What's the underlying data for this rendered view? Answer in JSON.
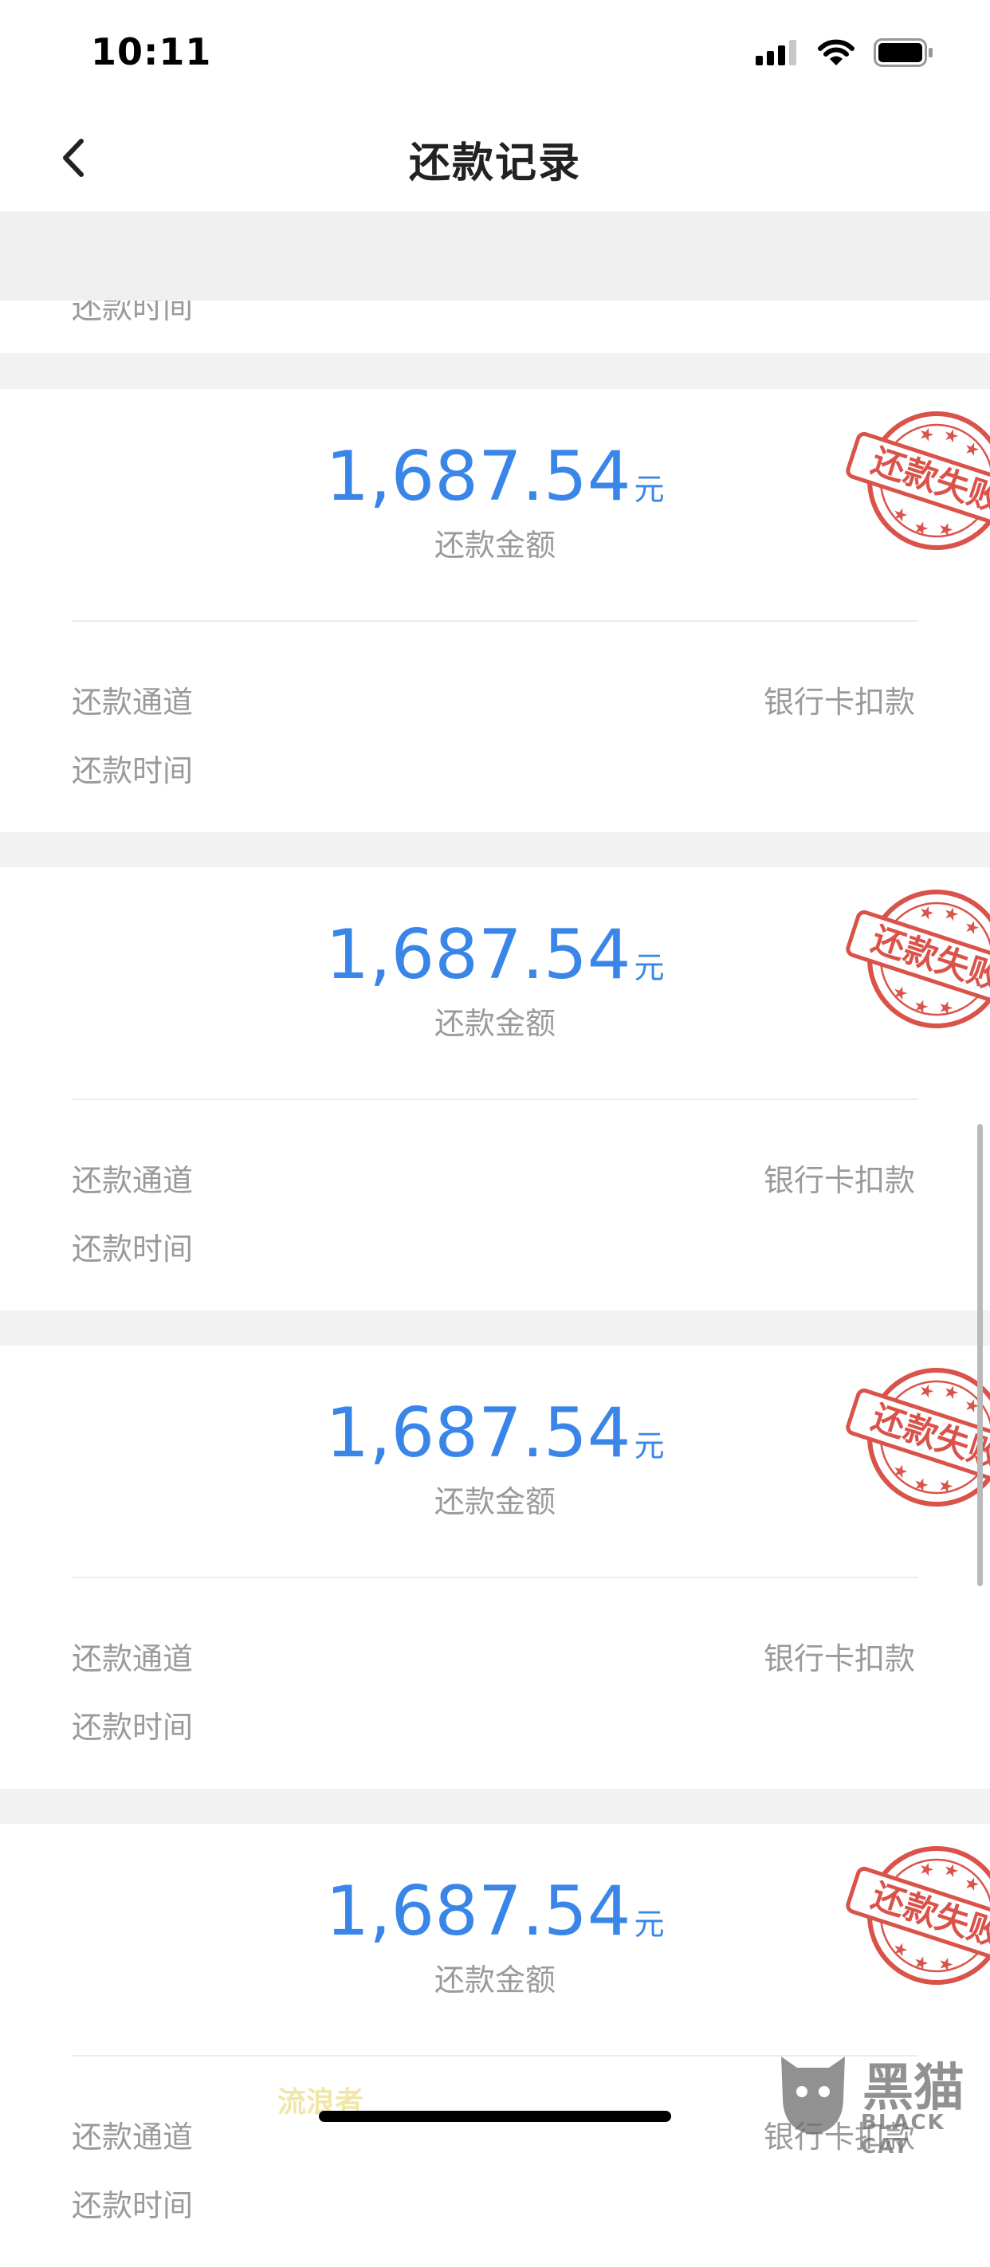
{
  "status_bar": {
    "time": "10:11"
  },
  "nav": {
    "title": "还款记录"
  },
  "partial_label": "还款时间",
  "records": [
    {
      "amount": "1,687.54",
      "unit": "元",
      "caption": "还款金额",
      "channel_label": "还款通道",
      "channel_value": "银行卡扣款",
      "time_label": "还款时间",
      "stamp": "还款失败"
    },
    {
      "amount": "1,687.54",
      "unit": "元",
      "caption": "还款金额",
      "channel_label": "还款通道",
      "channel_value": "银行卡扣款",
      "time_label": "还款时间",
      "stamp": "还款失败"
    },
    {
      "amount": "1,687.54",
      "unit": "元",
      "caption": "还款金额",
      "channel_label": "还款通道",
      "channel_value": "银行卡扣款",
      "time_label": "还款时间",
      "stamp": "还款失败"
    },
    {
      "amount": "1,687.54",
      "unit": "元",
      "caption": "还款金额",
      "channel_label": "还款通道",
      "channel_value": "银行卡扣款",
      "time_label": "还款时间",
      "stamp": "还款失败"
    }
  ],
  "watermark": {
    "text_left": "流浪者",
    "brand": "黑猫",
    "brand_sub": "BLACK CAT"
  },
  "colors": {
    "amount": "#3a86e8",
    "stamp": "#d9534a",
    "label": "#9a9a9a"
  },
  "icons": {
    "back": "chevron-left-icon",
    "signal": "signal-icon",
    "wifi": "wifi-icon",
    "battery": "battery-icon",
    "stamp": "failed-stamp-icon",
    "logo": "black-cat-logo-icon"
  }
}
